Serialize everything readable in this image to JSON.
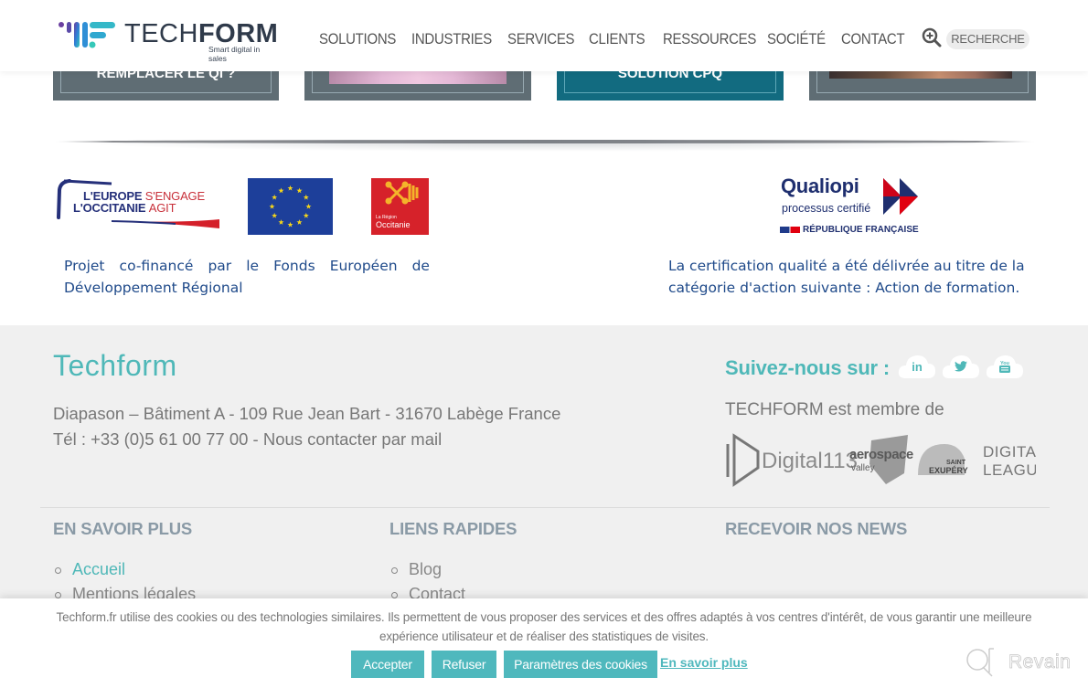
{
  "header": {
    "logo": {
      "brand_light": "TECH",
      "brand_bold": "FORM",
      "tagline": "Smart digital in sales"
    },
    "nav": [
      "SOLUTIONS",
      "INDUSTRIES",
      "SERVICES",
      "CLIENTS",
      "RESSOURCES",
      "SOCIÉTÉ",
      "CONTACT"
    ],
    "search_label": "RECHERCHE",
    "search_icon": "zoom-in-magnifier-icon"
  },
  "cards": [
    {
      "text": "REMPLACER LE QI ?",
      "style": "grey"
    },
    {
      "text": "",
      "style": "grey-image"
    },
    {
      "text": "SOLUTION CPQ",
      "style": "teal"
    },
    {
      "text": "",
      "style": "grey-image"
    }
  ],
  "funding": {
    "eu_engage_line1a": "L'EUROPE",
    "eu_engage_line1b": "S'ENGAGE",
    "eu_engage_line2a": "L'OCCITANIE",
    "eu_engage_line2b": "AGIT",
    "occitanie_small": "La Région",
    "occitanie_name": "Occitanie",
    "text_line1_words": [
      "Projet",
      "co-financé",
      "par",
      "le",
      "Fonds",
      "Européen",
      "de"
    ],
    "text_line2": "Développement Régional"
  },
  "qualiopi": {
    "title": "Qualiopi",
    "subtitle": "processus certifié",
    "republic": "RÉPUBLIQUE FRANÇAISE",
    "text": "La certification qualité a été délivrée au titre de la catégorie d'action suivante : Action de formation."
  },
  "footer": {
    "title": "Techform",
    "address": "Diapason – Bâtiment A - 109 Rue Jean Bart - 31670 Labège France",
    "phone_line": "Tél : +33 (0)5 61 00 77 00 - Nous contacter par mail",
    "follow_label": "Suivez-nous sur :",
    "social": [
      {
        "name": "linkedin",
        "glyph": "in"
      },
      {
        "name": "twitter",
        "glyph": "🐦"
      },
      {
        "name": "youtube",
        "glyph": "▶"
      }
    ],
    "member_label": "TECHFORM est membre de",
    "partners": [
      "Digital113",
      "aerospace valley",
      "SAINT EXUPÉRY",
      "DIGITAL LEAGUE"
    ],
    "columns": [
      {
        "heading": "EN SAVOIR PLUS",
        "links": [
          "Accueil",
          "Mentions légales"
        ]
      },
      {
        "heading": "LIENS RAPIDES",
        "links": [
          "Blog",
          "Contact"
        ]
      },
      {
        "heading": "RECEVOIR NOS NEWS",
        "links": []
      }
    ]
  },
  "cookie": {
    "text_line1": "Techform.fr utilise des cookies ou des technologies similaires. Ils permettent de vous proposer des services et des offres adaptés à vos centres d'intérêt, de vous garantir une meilleure",
    "text_line2": "expérience utilisateur et de réaliser des statistiques de visites.",
    "accept": "Accepter",
    "refuse": "Refuser",
    "settings": "Paramètres des cookies",
    "learn_more": "En savoir plus"
  },
  "watermark": "Revain",
  "colors": {
    "accent": "#4fb8bd",
    "nav_text": "#555555",
    "dark_blue": "#1f4a8a",
    "card_grey": "#5f6d74",
    "card_teal": "#126b80",
    "footer_bg": "#f0f0f0"
  }
}
